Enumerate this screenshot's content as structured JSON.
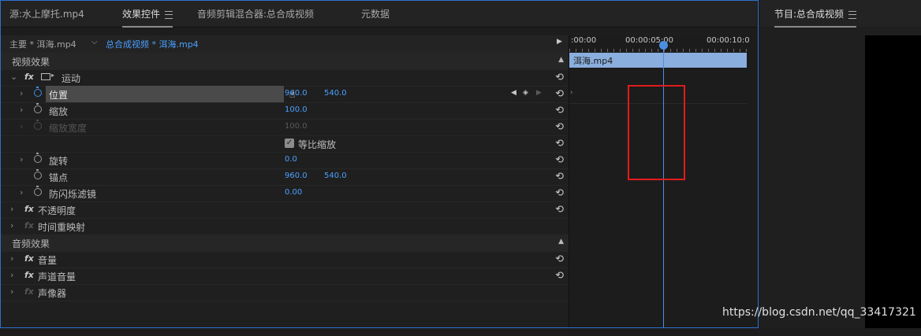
{
  "tabs": {
    "source": "源:水上摩托.mp4",
    "effect_controls": "效果控件",
    "audio_mixer": "音频剪辑混合器:总合成视频",
    "metadata": "元数据"
  },
  "program": {
    "title": "节目:总合成视频"
  },
  "clip_bar": {
    "master": "主要 * 洱海.mp4",
    "sequence": "总合成视频 * 洱海.mp4"
  },
  "timeline": {
    "ticks": [
      ":00:00",
      "00:00:05:00",
      "00:00:10:0"
    ],
    "clip_name": "洱海.mp4"
  },
  "video_effects": {
    "header": "视频效果",
    "motion": "运动",
    "position": {
      "label": "位置",
      "x": "960.0",
      "y": "540.0"
    },
    "scale": {
      "label": "缩放",
      "value": "100.0"
    },
    "scale_width": {
      "label": "缩放宽度",
      "value": "100.0"
    },
    "uniform_scale": "等比缩放",
    "rotation": {
      "label": "旋转",
      "value": "0.0"
    },
    "anchor": {
      "label": "锚点",
      "x": "960.0",
      "y": "540.0"
    },
    "anti_flicker": {
      "label": "防闪烁滤镜",
      "value": "0.00"
    },
    "opacity": "不透明度",
    "time_remap": "时间重映射"
  },
  "audio_effects": {
    "header": "音频效果",
    "volume": "音量",
    "channel_volume": "声道音量",
    "panner": "声像器"
  },
  "watermark": "https://blog.csdn.net/qq_33417321",
  "colors": {
    "accent": "#4aa0ff",
    "highlight_box": "#e21b1b",
    "clip": "#8aaedd"
  }
}
